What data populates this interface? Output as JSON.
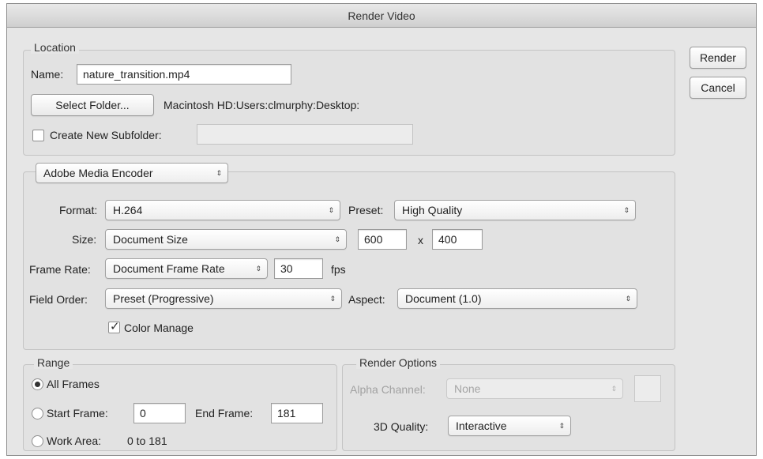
{
  "window": {
    "title": "Render Video"
  },
  "buttons": {
    "render": "Render",
    "cancel": "Cancel"
  },
  "location": {
    "group_label": "Location",
    "name_label": "Name:",
    "name_value": "nature_transition.mp4",
    "select_folder": "Select Folder...",
    "path": "Macintosh HD:Users:clmurphy:Desktop:",
    "subfolder_label": "Create New Subfolder:",
    "subfolder_checked": false,
    "subfolder_value": ""
  },
  "encoder": {
    "selected": "Adobe Media Encoder",
    "format_label": "Format:",
    "format_value": "H.264",
    "preset_label": "Preset:",
    "preset_value": "High Quality",
    "size_label": "Size:",
    "size_value": "Document Size",
    "width": "600",
    "x_sep": "x",
    "height": "400",
    "frame_rate_label": "Frame Rate:",
    "frame_rate_value": "Document Frame Rate",
    "fps_value": "30",
    "fps_unit": "fps",
    "field_order_label": "Field Order:",
    "field_order_value": "Preset (Progressive)",
    "aspect_label": "Aspect:",
    "aspect_value": "Document (1.0)",
    "color_manage_label": "Color Manage",
    "color_manage_checked": true
  },
  "range": {
    "group_label": "Range",
    "all_frames": "All Frames",
    "start_frame_label": "Start Frame:",
    "start_frame_value": "0",
    "end_frame_label": "End Frame:",
    "end_frame_value": "181",
    "work_area_label": "Work Area:",
    "work_area_value": "0 to 181",
    "selected": "all_frames"
  },
  "render_options": {
    "group_label": "Render Options",
    "alpha_label": "Alpha Channel:",
    "alpha_value": "None",
    "quality_label": "3D Quality:",
    "quality_value": "Interactive"
  },
  "icons": {
    "popup_arrows": "⇕",
    "checkmark": "✓"
  },
  "colors": {
    "window_bg": "#e6e6e6",
    "group_border": "#c4c4c4",
    "disabled_text": "#a2a2a2"
  }
}
